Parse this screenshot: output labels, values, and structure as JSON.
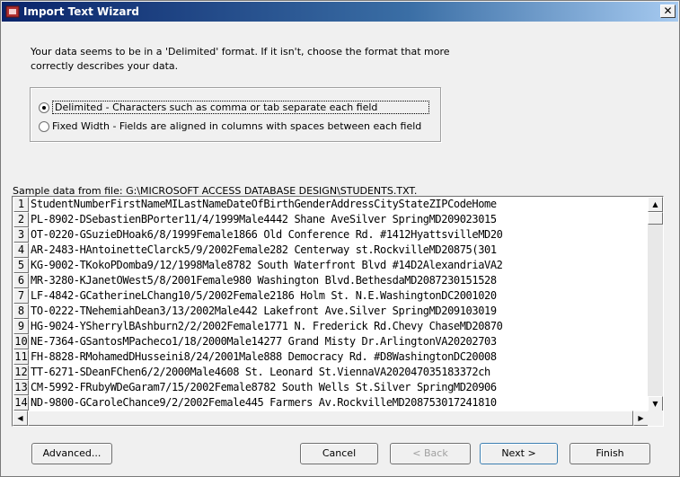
{
  "window": {
    "title": "Import Text Wizard",
    "close_label": "✕"
  },
  "intro": {
    "text": "Your data seems to be in a 'Delimited' format. If it isn't, choose the format that more correctly describes your data."
  },
  "format_options": {
    "delimited": {
      "label": "Delimited - Characters such as comma or tab separate each field",
      "selected": true
    },
    "fixed_width": {
      "label": "Fixed Width - Fields are aligned in columns with spaces between each field",
      "selected": false
    }
  },
  "sample": {
    "label": "Sample data from file: G:\\MICROSOFT ACCESS DATABASE DESIGN\\STUDENTS.TXT.",
    "rows": [
      {
        "num": "1",
        "text": "StudentNumberFirstNameMILastNameDateOfBirthGenderAddressCityStateZIPCodeHome"
      },
      {
        "num": "2",
        "text": "PL-8902-DSebastienBPorter11/4/1999Male4442 Shane AveSilver SpringMD209023015"
      },
      {
        "num": "3",
        "text": "OT-0220-GSuzieDHoak6/8/1999Female1866 Old Conference Rd. #1412HyattsvilleMD20"
      },
      {
        "num": "4",
        "text": "AR-2483-HAntoinetteClarck5/9/2002Female282 Centerway st.RockvilleMD20875(301"
      },
      {
        "num": "5",
        "text": "KG-9002-TKokoPDomba9/12/1998Male8782 South Waterfront Blvd #14D2AlexandriaVA2"
      },
      {
        "num": "6",
        "text": "MR-3280-KJanetOWest5/8/2001Female980 Washington Blvd.BethesdaMD2087230151528"
      },
      {
        "num": "7",
        "text": "LF-4842-GCatherineLChang10/5/2002Female2186 Holm St. N.E.WashingtonDC2001020"
      },
      {
        "num": "8",
        "text": "TO-0222-TNehemiahDean3/13/2002Male442 Lakefront Ave.Silver SpringMD209103019"
      },
      {
        "num": "9",
        "text": "HG-9024-YSherrylBAshburn2/2/2002Female1771 N. Frederick Rd.Chevy ChaseMD20870"
      },
      {
        "num": "10",
        "text": "NE-7364-GSantosMPacheco1/18/2000Male14277 Grand Misty Dr.ArlingtonVA20202703"
      },
      {
        "num": "11",
        "text": "FH-8828-RMohamedDHusseini8/24/2001Male888 Democracy Rd. #D8WashingtonDC20008"
      },
      {
        "num": "12",
        "text": "TT-6271-SDeanFChen6/2/2000Male4608 St. Leonard St.ViennaVA202047035183372ch"
      },
      {
        "num": "13",
        "text": "CM-5992-FRubyWDeGaram7/15/2002Female8782 South Wells St.Silver SpringMD20906"
      },
      {
        "num": "14",
        "text": "ND-9800-GCaroleChance9/2/2002Female445 Farmers Av.RockvilleMD208753017241810"
      }
    ]
  },
  "buttons": {
    "advanced": "Advanced...",
    "cancel": "Cancel",
    "back": "< Back",
    "next": "Next >",
    "finish": "Finish"
  },
  "icons": {
    "app": "access-icon",
    "scroll_up": "▲",
    "scroll_down": "▼",
    "scroll_left": "◀",
    "scroll_right": "▶"
  }
}
